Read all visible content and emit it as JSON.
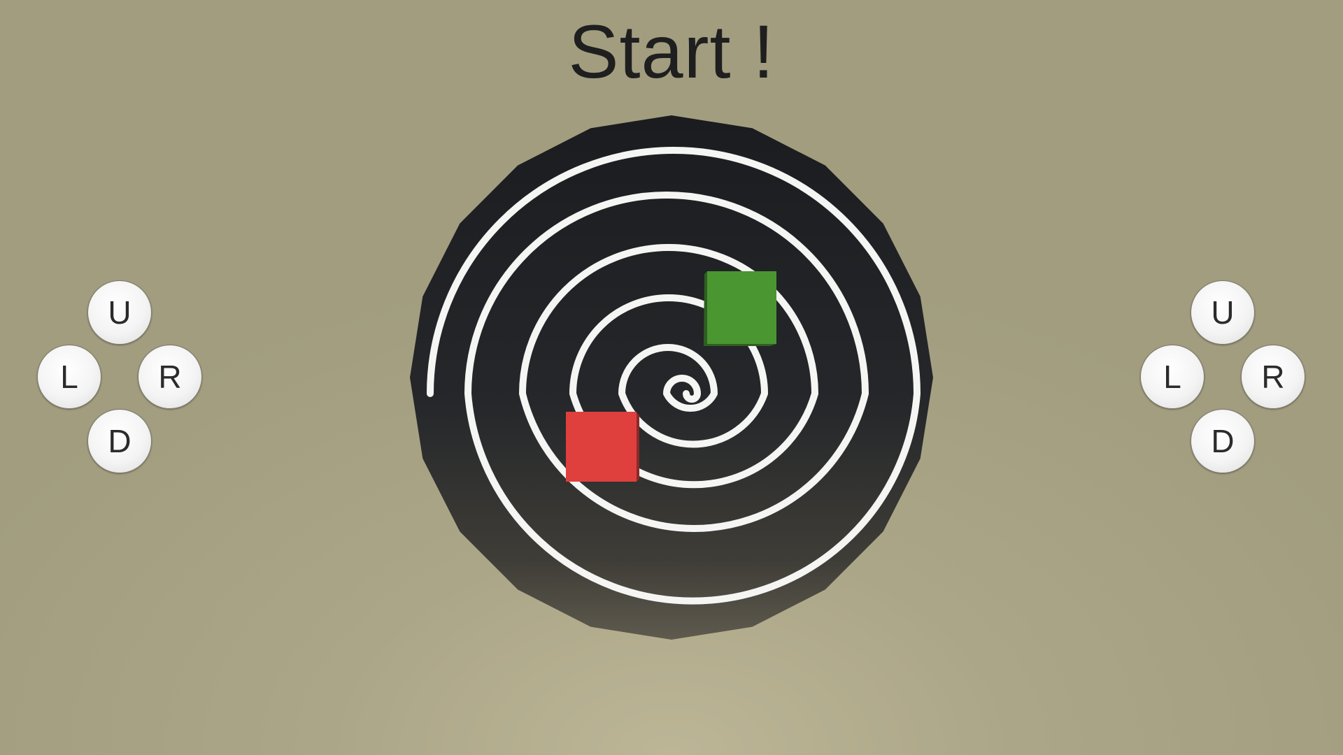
{
  "title": "Start !",
  "board": {
    "colors": {
      "disc_top": "#1a1c1f",
      "disc_bottom": "#5e5a4e",
      "spiral": "#f5f5f3"
    }
  },
  "players": [
    {
      "name": "green",
      "color": "#4a9630"
    },
    {
      "name": "red",
      "color": "#e0403d"
    }
  ],
  "controls": {
    "left": {
      "up": "U",
      "left": "L",
      "right": "R",
      "down": "D"
    },
    "right": {
      "up": "U",
      "left": "L",
      "right": "R",
      "down": "D"
    }
  }
}
